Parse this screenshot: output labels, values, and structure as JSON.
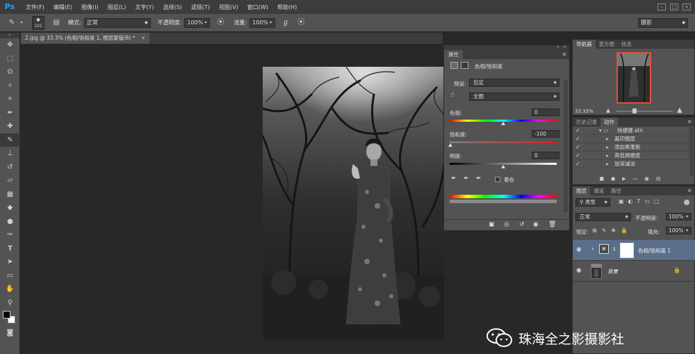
{
  "app": {
    "logo": "Ps"
  },
  "menu": [
    "文件(F)",
    "编辑(E)",
    "图像(I)",
    "图层(L)",
    "文字(Y)",
    "选择(S)",
    "滤镜(T)",
    "视图(V)",
    "窗口(W)",
    "帮助(H)"
  ],
  "options": {
    "brush_size": "101",
    "mode_label": "模式:",
    "mode_value": "正常",
    "opacity_label": "不透明度:",
    "opacity_value": "100%",
    "flow_label": "流量:",
    "flow_value": "100%",
    "workspace": "摄影"
  },
  "document": {
    "tab_title": "2.jpg @ 33.3% (色相/饱和度 1, 图层蒙版/8) *"
  },
  "properties": {
    "panel_tab": "属性",
    "title": "色相/饱和度",
    "preset_label": "预设:",
    "preset_value": "自定",
    "channel_value": "全图",
    "hue_label": "色相:",
    "hue_value": "0",
    "saturation_label": "饱和度:",
    "saturation_value": "-100",
    "lightness_label": "明度:",
    "lightness_value": "0",
    "colorize_label": "着色"
  },
  "navigator": {
    "tabs": [
      "导航器",
      "直方图",
      "信息"
    ],
    "zoom": "33.33%"
  },
  "actions": {
    "tabs": [
      "历史记录",
      "动作"
    ],
    "items": [
      "快捷键.atn",
      "盖印图层",
      "添加黑果新",
      "高低频磨皮",
      "加深减淡"
    ]
  },
  "layers": {
    "tabs": [
      "图层",
      "通道",
      "路径"
    ],
    "filter_label": "类型",
    "blend_mode": "正常",
    "opacity_label": "不透明度:",
    "opacity_value": "100%",
    "lock_label": "锁定:",
    "fill_label": "填充:",
    "fill_value": "100%",
    "items": [
      {
        "name": "色相/饱和度 1"
      },
      {
        "name": "背景"
      }
    ]
  },
  "watermark": {
    "text": "珠海全之影摄影社"
  },
  "colors": {
    "hue_strip": "rainbow",
    "ui_bg": "#535353",
    "accent_nav_frame": "#e0503a",
    "selected_layer": "#5a6e8a"
  }
}
